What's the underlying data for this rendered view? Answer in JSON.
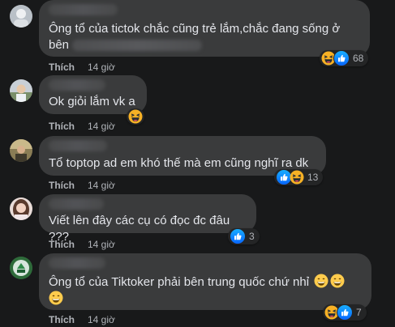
{
  "comments": [
    {
      "text1": "Ông tổ của tictok chắc cũng trẻ lắm,chắc đang sống ở",
      "text2": "bên",
      "action": "Thích",
      "time": "14 giờ",
      "reactions": [
        "haha",
        "like"
      ],
      "count": "68"
    },
    {
      "text": "Ok giỏi lắm vk a",
      "action": "Thích",
      "time": "14 giờ",
      "reactions": [
        "haha"
      ],
      "count": ""
    },
    {
      "text": "Tổ toptop ad em khó thế mà em cũng nghĩ ra dk",
      "action": "Thích",
      "time": "14 giờ",
      "reactions": [
        "like",
        "haha"
      ],
      "count": "13"
    },
    {
      "text": "Viết lên đây các cụ có đọc đc đâu ???",
      "action": "Thích",
      "time": "14 giờ",
      "reactions": [
        "like"
      ],
      "count": "3"
    },
    {
      "text": "Ông tổ của Tiktoker phải bên trung quốc chứ nhỉ",
      "action": "Thích",
      "time": "14 giờ",
      "reactions": [
        "haha",
        "like"
      ],
      "count": "7"
    }
  ]
}
